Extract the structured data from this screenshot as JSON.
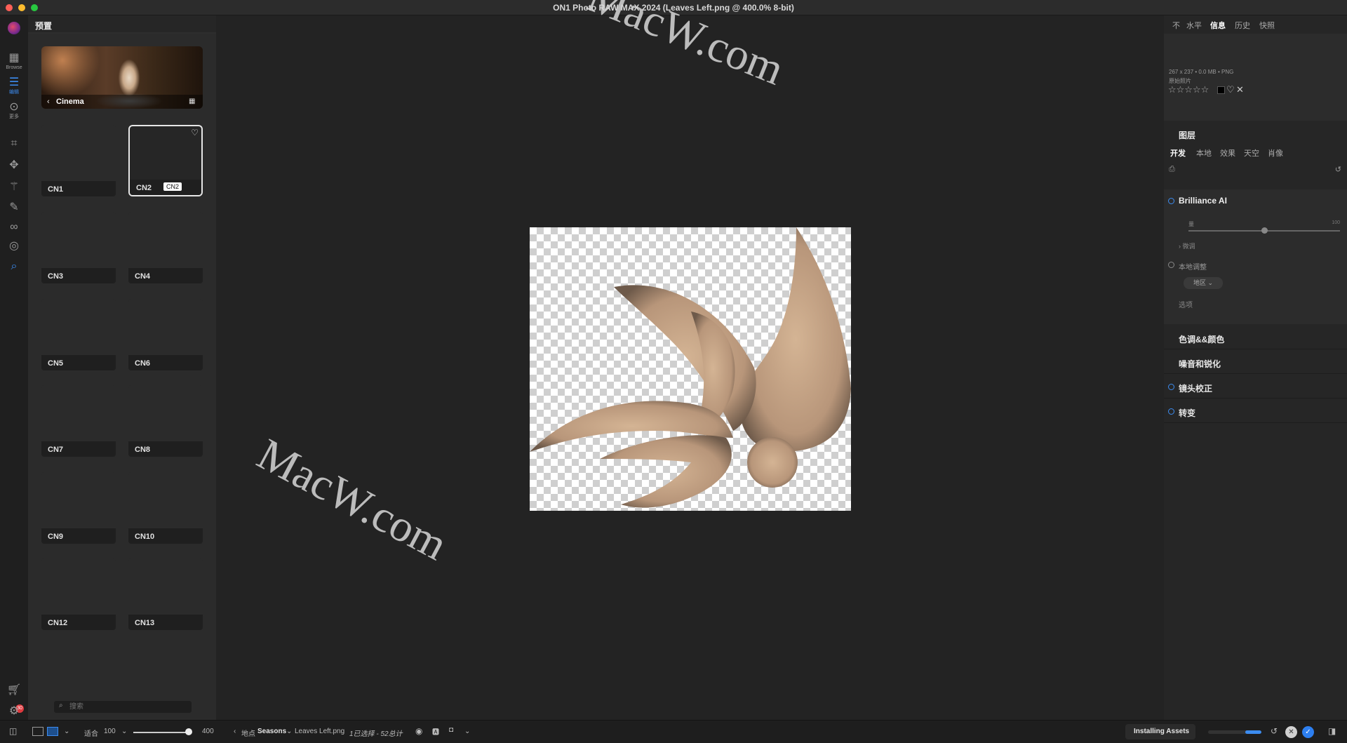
{
  "window": {
    "title": "ON1 Photo RAW MAX 2024 (Leaves Left.png @ 400.0% 8-bit)"
  },
  "toolbar": {
    "browse_label": "Browse",
    "edit_label": "编辑",
    "more_label": "更多",
    "cart_badge": "30"
  },
  "presets": {
    "title": "预置",
    "category": "Cinema",
    "items": [
      "CN1",
      "CN2",
      "CN3",
      "CN4",
      "CN5",
      "CN6",
      "CN7",
      "CN8",
      "CN9",
      "CN10",
      "CN12",
      "CN13"
    ],
    "selected": "CN2",
    "tooltip": "CN2",
    "search_placeholder": "搜索"
  },
  "right_panel": {
    "top_tabs": [
      "不",
      "水平",
      "信息",
      "历史",
      "快照"
    ],
    "active_top_tab": "信息",
    "info": {
      "dimensions": "267 x 237 • 0.0 MB • PNG",
      "original": "原始照片",
      "stars": "☆☆☆☆☆"
    },
    "layers_title": "图层",
    "develop_tabs": [
      "开发",
      "本地",
      "效果",
      "天空",
      "肖像"
    ],
    "active_develop_tab": "开发",
    "brilliance": {
      "title": "Brilliance AI",
      "amount_label": "量",
      "amount_max": "100",
      "amount_value": 50,
      "fine_tune": "微调",
      "local_adjust": "本地调整",
      "region_button": "地区",
      "options": "选项"
    },
    "sections": [
      {
        "title": "色调&&颜色",
        "ring": false
      },
      {
        "title": "噪音和锐化",
        "ring": false
      },
      {
        "title": "镜头校正",
        "ring": true
      },
      {
        "title": "转变",
        "ring": true
      }
    ]
  },
  "bottom_bar": {
    "fit_label": "适合",
    "zoom_value": "100",
    "zoom_max": "400",
    "location_prefix": "地点",
    "location_folder": "Seasons",
    "file_name": "Leaves Left.png",
    "selection_info": "1已选择 - 52总计",
    "install_label": "Installing Assets",
    "install_progress": 0.3
  },
  "watermark": {
    "text": "MacW.com"
  },
  "colors": {
    "accent": "#3c8cf0",
    "background": "#232323",
    "leaf": "#c29e7c"
  }
}
